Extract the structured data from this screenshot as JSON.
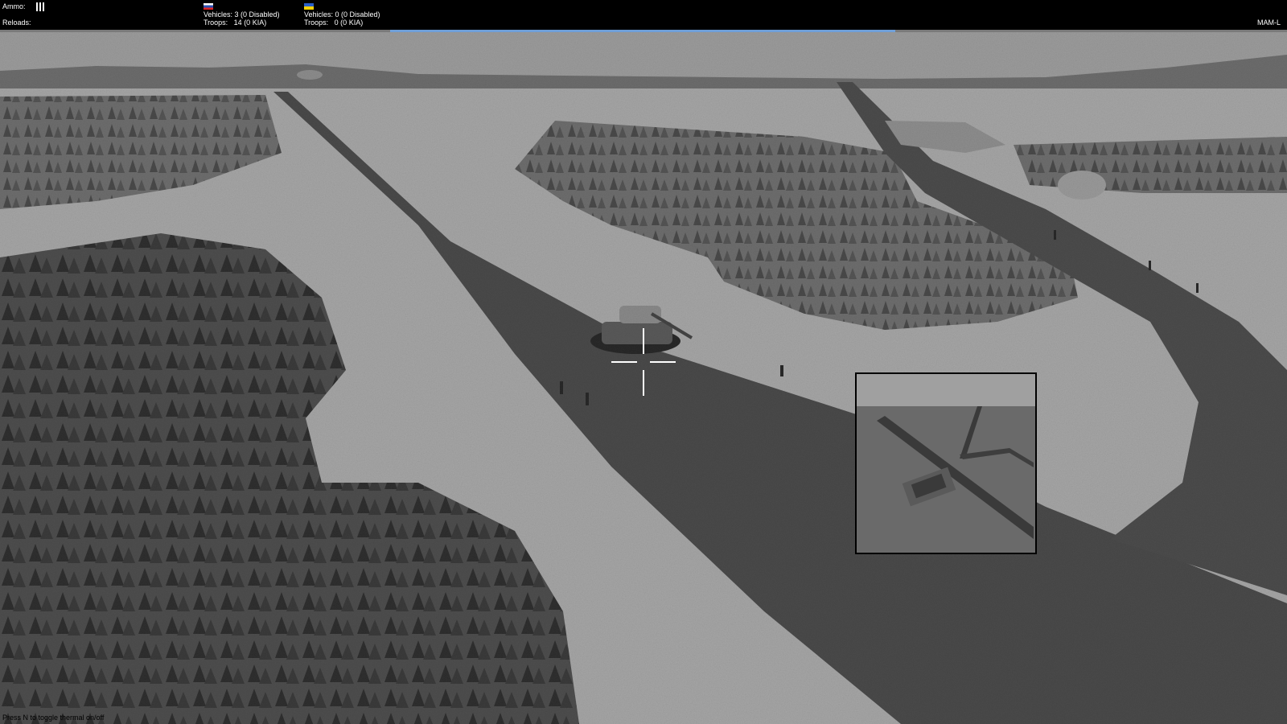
{
  "hud": {
    "ammo_label": "Ammo:",
    "ammo_count": 3,
    "reloads_label": "Reloads:",
    "russia": {
      "flag_icon": "russia-flag-icon",
      "vehicles": "Vehicles: 3 (0 Disabled)",
      "troops": "Troops:   14 (0 KIA)"
    },
    "ukraine": {
      "flag_icon": "ukraine-flag-icon",
      "vehicles": "Vehicles: 0 (0 Disabled)",
      "troops": "Troops:   0 (0 KIA)"
    },
    "weapon": "MAM-L"
  },
  "status_hint": "Press N to toggle thermal on/off",
  "scene": {
    "mode": "thermal-greyscale",
    "crosshair_icon": "crosshair-reticle-icon",
    "minimap_icon": "minimap-view"
  }
}
